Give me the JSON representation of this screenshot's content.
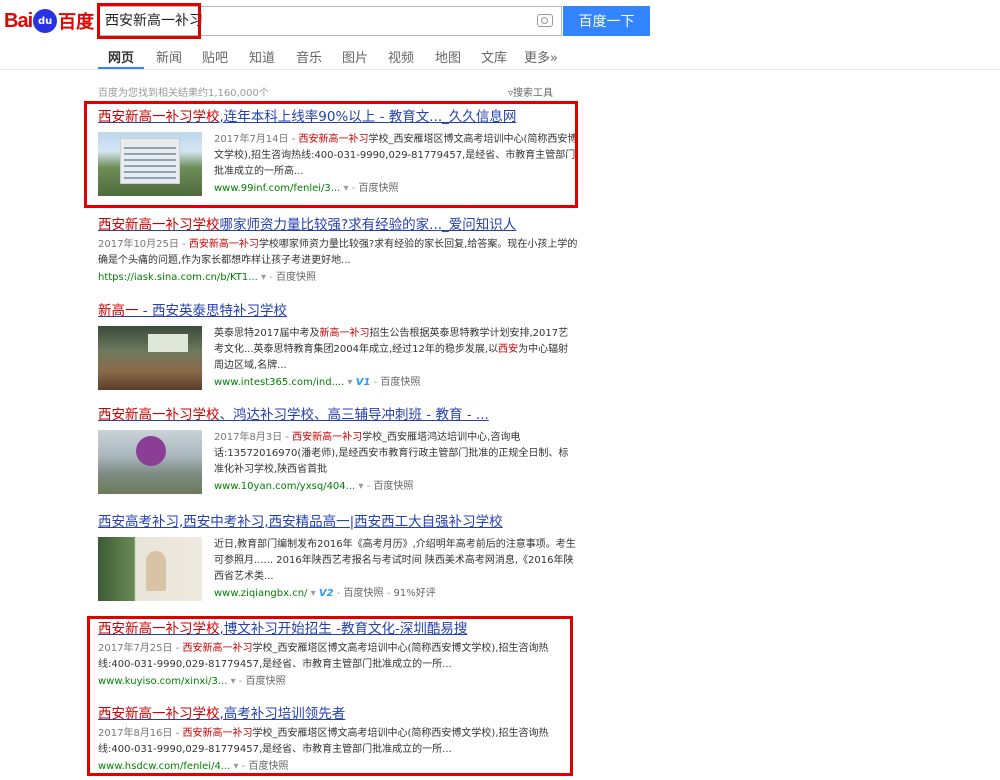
{
  "logo": {
    "bai": "Bai",
    "du": "du",
    "baidu_cn": "百度"
  },
  "search": {
    "query": "西安新高一补习",
    "button": "百度一下"
  },
  "nav": [
    {
      "label": "网页",
      "active": true
    },
    {
      "label": "新闻"
    },
    {
      "label": "贴吧"
    },
    {
      "label": "知道"
    },
    {
      "label": "音乐"
    },
    {
      "label": "图片"
    },
    {
      "label": "视频"
    },
    {
      "label": "地图"
    },
    {
      "label": "文库"
    },
    {
      "label": "更多»"
    }
  ],
  "stats": "百度为您找到相关结果约1,160,000个",
  "tools": "搜索工具",
  "results": [
    {
      "title_hl": "西安新高一补习学校",
      "title_rest": ",连年本科上线率90%以上 - 教育文..._久久信息网",
      "date": "2017年7月14日 - ",
      "desc_hl": "西安新高一补习",
      "desc_rest": "学校_西安雁塔区博文高考培训中心(简称西安博文学校),招生咨询热线:400-031-9990,029-81779457,是经省、市教育主管部门批准成立的一所高...",
      "url": "www.99inf.com/fenlei/3...",
      "snapshot": "百度快照"
    },
    {
      "title_hl": "西安新高一补习学校",
      "title_rest": "哪家师资力量比较强?求有经验的家..._爱问知识人",
      "date": "2017年10月25日 - ",
      "desc_hl": "西安新高一补习",
      "desc_rest": "学校哪家师资力量比较强?求有经验的家长回复,给答案。现在小孩上学的确是个头痛的问题,作为家长都想咋样让孩子考进更好地...",
      "url": "https://iask.sina.com.cn/b/KT1...",
      "snapshot": "百度快照"
    },
    {
      "title_hl": "新高一",
      "title_rest": " - 西安英泰思特补习学校",
      "desc_pre": "英泰思特2017届中考及",
      "desc_hl": "新高一补习",
      "desc_mid": "招生公告根据英泰思特教学计划安排,2017艺考文化...英泰思特教育集团2004年成立,经过12年的稳步发展,以",
      "desc_hl2": "西安",
      "desc_rest": "为中心辐射周边区域,名牌...",
      "url": "www.intest365.com/ind....",
      "v": "V1",
      "snapshot": "百度快照"
    },
    {
      "title_hl": "西安新高一补习学校",
      "title_rest": "、鸿达补习学校、高三辅导冲刺班 - 教育 - ...",
      "date": "2017年8月3日 - ",
      "desc_hl": "西安新高一补习",
      "desc_rest": "学校_西安雁塔鸿达培训中心,咨询电话:13572016970(潘老师),是经西安市教育行政主管部门批准的正规全日制、标准化补习学校,陕西省首批",
      "url": "www.10yan.com/yxsq/404...",
      "snapshot": "百度快照"
    },
    {
      "title": "西安高考补习,西安中考补习,西安精品高一|西安西工大自强补习学校",
      "desc_rest": "近日,教育部门编制发布2016年《高考月历》,介绍明年高考前后的注意事项。考生可参照月...... 2016年陕西艺考报名与考试时间 陕西美术高考网消息,《2016年陕西省艺术类...",
      "url": "www.ziqiangbx.cn/",
      "v": "V2",
      "snapshot": "百度快照",
      "rating": "91%好评"
    },
    {
      "title_hl": "西安新高一补习学校",
      "title_rest": ",博文补习开始招生 -教育文化-深圳酷易搜",
      "date": "2017年7月25日 - ",
      "desc_hl": "西安新高一补习",
      "desc_rest": "学校_西安雁塔区博文高考培训中心(简称西安博文学校),招生咨询热线:400-031-9990,029-81779457,是经省、市教育主管部门批准成立的一所...",
      "url": "www.kuyiso.com/xinxi/3...",
      "snapshot": "百度快照"
    },
    {
      "title_hl": "西安新高一补习学校",
      "title_rest": ",高考补习培训领先者",
      "date": "2017年8月16日 - ",
      "desc_hl": "西安新高一补习",
      "desc_rest": "学校_西安雁塔区博文高考培训中心(简称西安博文学校),招生咨询热线:400-031-9990,029-81779457,是经省、市教育主管部门批准成立的一所...",
      "url": "www.hsdcw.com/fenlei/4...",
      "snapshot": "百度快照"
    }
  ]
}
